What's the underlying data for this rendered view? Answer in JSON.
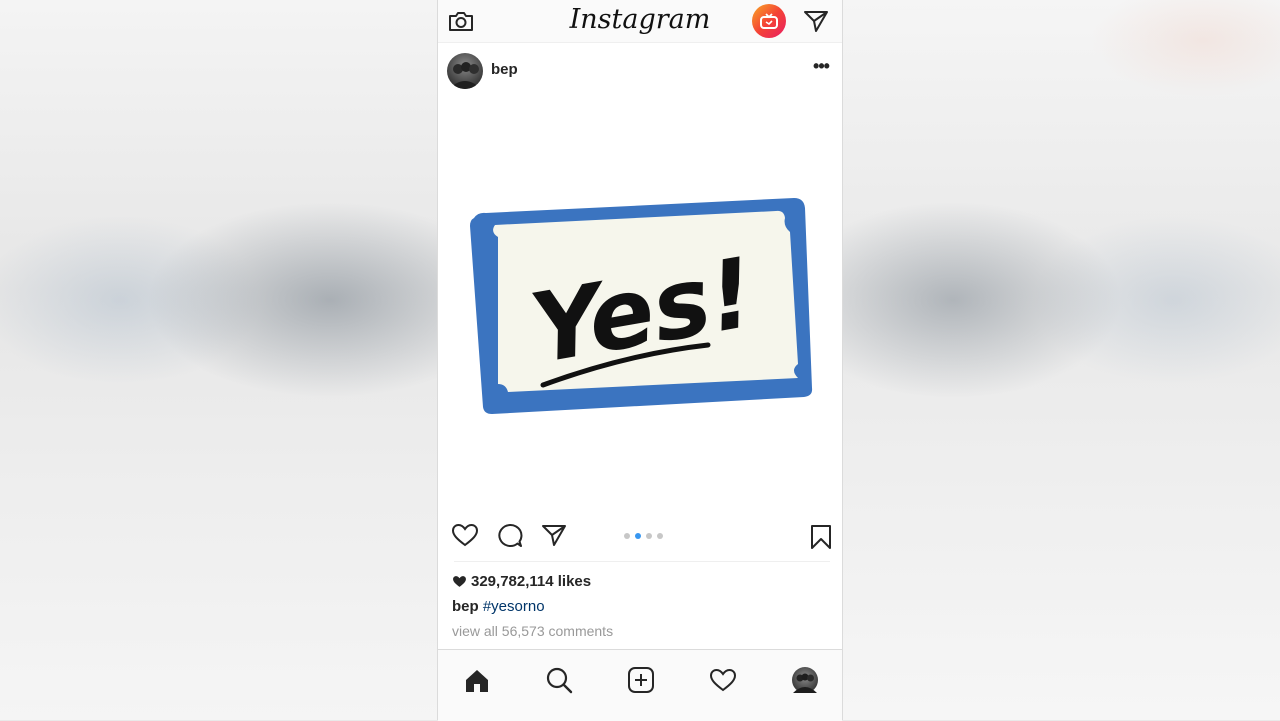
{
  "app": {
    "logo_text": "Instagram"
  },
  "post": {
    "username": "bep",
    "more_label": "•••",
    "image_text": "Yes!",
    "carousel": {
      "count": 4,
      "active_index": 1
    },
    "likes": "329,782,114 likes",
    "caption_user": "bep",
    "caption_tag": "#yesorno",
    "view_comments": "view all 56,573 comments"
  },
  "colors": {
    "accent_blue": "#3897f0",
    "hashtag": "#003569",
    "card_border": "#3b74c0",
    "card_fill": "#f6f6ec"
  },
  "icons": {
    "top_left": "camera-icon",
    "top_igtv": "igtv-icon",
    "top_right": "direct-message-icon",
    "actions": [
      "heart-outline-icon",
      "comment-icon",
      "share-icon",
      "bookmark-icon"
    ],
    "nav": [
      "home-icon",
      "search-icon",
      "add-post-icon",
      "activity-heart-icon",
      "profile-avatar-icon"
    ]
  }
}
